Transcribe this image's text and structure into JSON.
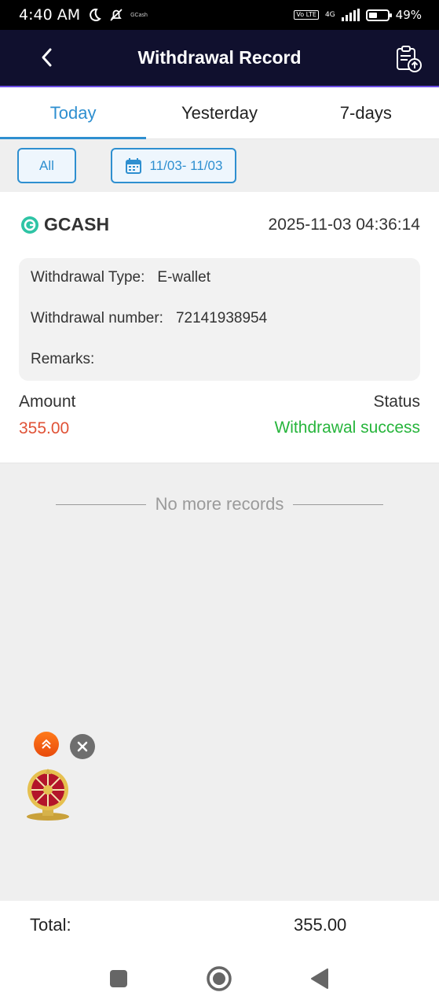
{
  "status_bar": {
    "time": "4:40 AM",
    "notif_text": "GCash",
    "network": "4G",
    "volte": "Vo LTE",
    "battery": "49%",
    "battery_level": 0.49
  },
  "header": {
    "title": "Withdrawal Record"
  },
  "tabs": [
    {
      "label": "Today",
      "active": true
    },
    {
      "label": "Yesterday",
      "active": false
    },
    {
      "label": "7-days",
      "active": false
    }
  ],
  "filters": {
    "type_label": "All",
    "date_range": "11/03- 11/03"
  },
  "record": {
    "method": "GCASH",
    "datetime": "2025-11-03 04:36:14",
    "type_label": "Withdrawal Type:",
    "type_value": "E-wallet",
    "number_label": "Withdrawal number:",
    "number_value": "72141938954",
    "remarks_label": "Remarks:",
    "remarks_value": "",
    "amount_label": "Amount",
    "amount_value": "355.00",
    "status_label": "Status",
    "status_value": "Withdrawal success"
  },
  "list_end": "No more records",
  "footer": {
    "total_label": "Total:",
    "total_value": "355.00"
  },
  "colors": {
    "accent": "#2e8fd0",
    "header_bg": "#10102e",
    "amount": "#e05236",
    "success": "#27b53c"
  },
  "icons": {
    "back": "chevron-left-icon",
    "record": "clipboard-upload-icon",
    "calendar": "calendar-icon",
    "gcash": "gcash-logo-icon",
    "scroll_top": "double-chevron-up-icon",
    "close": "close-icon",
    "wheel": "prize-wheel-icon"
  }
}
